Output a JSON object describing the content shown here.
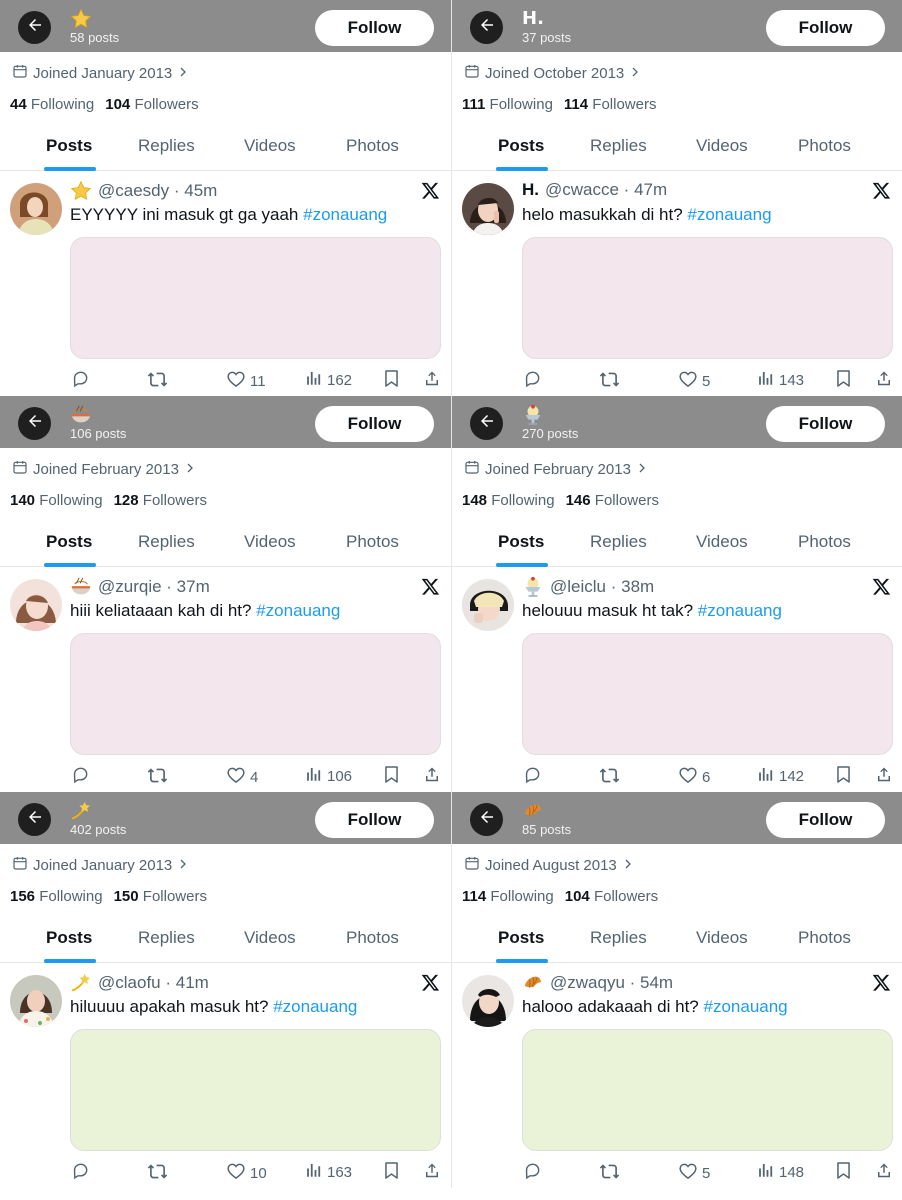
{
  "common": {
    "follow_label": "Follow",
    "tabs": [
      "Posts",
      "Replies",
      "Videos",
      "Photos"
    ],
    "hashtag": "#zonauang",
    "colors": {
      "header_bg": "#8c8c8c",
      "accent": "#1d9bf0",
      "media_pink": "#f3e6ec",
      "media_green": "#eaf3d7"
    }
  },
  "panels": [
    {
      "header_emoji_icon": "star-emoji",
      "header_name": "",
      "posts_count": "58 posts",
      "joined": "Joined January 2013",
      "following": "44",
      "following_label": "Following",
      "followers": "104",
      "followers_label": "Followers",
      "tweet": {
        "emoji_icon": "star-emoji",
        "display_name": "",
        "handle": "@caesdy",
        "time": "45m",
        "text": "EYYYYY ini masuk gt ga yaah",
        "media_color": "#f3e6ec",
        "likes": "11",
        "views": "162"
      }
    },
    {
      "header_emoji_icon": "",
      "header_name": "H.",
      "posts_count": "37 posts",
      "joined": "Joined October 2013",
      "following": "111",
      "following_label": "Following",
      "followers": "114",
      "followers_label": "Followers",
      "tweet": {
        "emoji_icon": "",
        "display_name": "H.",
        "handle": "@cwacce",
        "time": "47m",
        "text": "helo masukkah di ht?",
        "media_color": "#f3e6ec",
        "likes": "5",
        "views": "143"
      }
    },
    {
      "header_emoji_icon": "noodle-bowl-emoji",
      "header_name": "",
      "posts_count": "106 posts",
      "joined": "Joined February 2013",
      "following": "140",
      "following_label": "Following",
      "followers": "128",
      "followers_label": "Followers",
      "tweet": {
        "emoji_icon": "noodle-bowl-emoji",
        "display_name": "",
        "handle": "@zurqie",
        "time": "37m",
        "text": "hiii keliataaan kah di ht?",
        "media_color": "#f3e6ec",
        "likes": "4",
        "views": "106"
      }
    },
    {
      "header_emoji_icon": "ice-cream-emoji",
      "header_name": "",
      "posts_count": "270 posts",
      "joined": "Joined February 2013",
      "following": "148",
      "following_label": "Following",
      "followers": "146",
      "followers_label": "Followers",
      "tweet": {
        "emoji_icon": "ice-cream-emoji",
        "display_name": "",
        "handle": "@leiclu",
        "time": "38m",
        "text": "helouuu masuk ht tak?",
        "media_color": "#f3e6ec",
        "likes": "6",
        "views": "142"
      }
    },
    {
      "header_emoji_icon": "dizzy-star-emoji",
      "header_name": "",
      "posts_count": "402 posts",
      "joined": "Joined January 2013",
      "following": "156",
      "following_label": "Following",
      "followers": "150",
      "followers_label": "Followers",
      "tweet": {
        "emoji_icon": "dizzy-star-emoji",
        "display_name": "",
        "handle": "@claofu",
        "time": "41m",
        "text": "hiluuuu apakah masuk ht?",
        "media_color": "#eaf3d7",
        "likes": "10",
        "views": "163"
      }
    },
    {
      "header_emoji_icon": "croissant-emoji",
      "header_name": "",
      "posts_count": "85 posts",
      "joined": "Joined August 2013",
      "following": "114",
      "following_label": "Following",
      "followers": "104",
      "followers_label": "Followers",
      "tweet": {
        "emoji_icon": "croissant-emoji",
        "display_name": "",
        "handle": "@zwaqyu",
        "time": "54m",
        "text": "halooo adakaaah di ht?",
        "media_color": "#eaf3d7",
        "likes": "5",
        "views": "148"
      }
    }
  ]
}
